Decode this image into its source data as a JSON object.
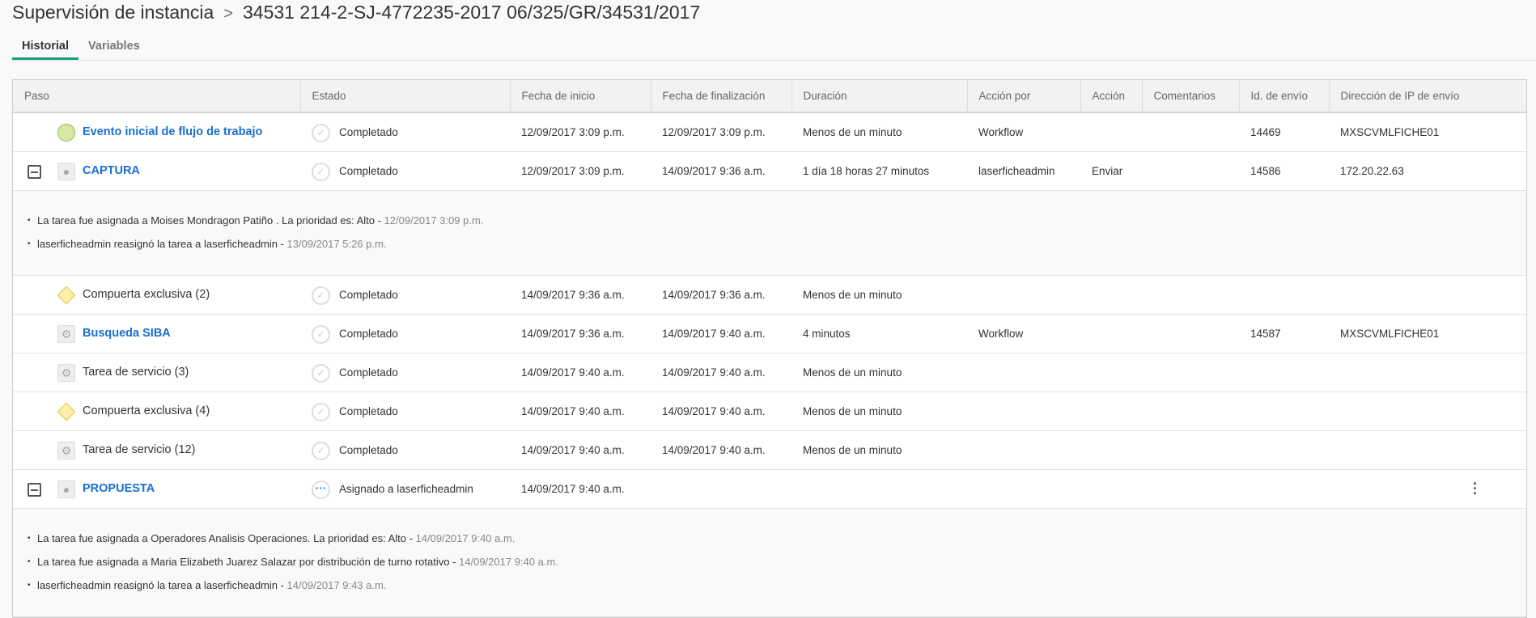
{
  "header": {
    "title": "Supervisión de instancia",
    "instance": "34531 214-2-SJ-4772235-2017 06/325/GR/34531/2017"
  },
  "tabs": [
    "Historial",
    "Variables"
  ],
  "columns": [
    "Paso",
    "Estado",
    "Fecha de inicio",
    "Fecha de finalización",
    "Duración",
    "Acción por",
    "Acción",
    "Comentarios",
    "Id. de envío",
    "Dirección de IP de envío"
  ],
  "rows": [
    {
      "icon": "start-event-icon",
      "paso": "Evento inicial de flujo de trabajo",
      "link": true,
      "estado": "Completado",
      "inicio": "12/09/2017 3:09 p.m.",
      "fin": "12/09/2017 3:09 p.m.",
      "duracion": "Menos de un minuto",
      "por": "Workflow",
      "accion": "",
      "comentarios": "",
      "id": "14469",
      "ip": "MXSCVMLFICHE01"
    },
    {
      "icon": "user-task-icon",
      "expandable": true,
      "paso": "CAPTURA",
      "link": true,
      "estado": "Completado",
      "inicio": "12/09/2017 3:09 p.m.",
      "fin": "14/09/2017 9:36 a.m.",
      "duracion": "1 día 18 horas 27 minutos",
      "por": "laserficheadmin",
      "accion": "Enviar",
      "comentarios": "",
      "id": "14586",
      "ip": "172.20.22.63",
      "details": [
        {
          "text": "La tarea fue asignada a Moises Mondragon Patiño . La prioridad es: Alto - ",
          "ts": "12/09/2017 3:09 p.m."
        },
        {
          "text": "laserficheadmin reasignó la tarea a laserficheadmin - ",
          "ts": "13/09/2017 5:26 p.m."
        }
      ]
    },
    {
      "icon": "gateway-icon",
      "paso": "Compuerta exclusiva (2)",
      "estado": "Completado",
      "inicio": "14/09/2017 9:36 a.m.",
      "fin": "14/09/2017 9:36 a.m.",
      "duracion": "Menos de un minuto",
      "por": "",
      "accion": "",
      "comentarios": "",
      "id": "",
      "ip": ""
    },
    {
      "icon": "service-task-icon",
      "paso": "Busqueda SIBA",
      "link": true,
      "estado": "Completado",
      "inicio": "14/09/2017 9:36 a.m.",
      "fin": "14/09/2017 9:40 a.m.",
      "duracion": "4 minutos",
      "por": "Workflow",
      "accion": "",
      "comentarios": "",
      "id": "14587",
      "ip": "MXSCVMLFICHE01"
    },
    {
      "icon": "service-task-icon",
      "paso": "Tarea de servicio (3)",
      "estado": "Completado",
      "inicio": "14/09/2017 9:40 a.m.",
      "fin": "14/09/2017 9:40 a.m.",
      "duracion": "Menos de un minuto",
      "por": "",
      "accion": "",
      "comentarios": "",
      "id": "",
      "ip": ""
    },
    {
      "icon": "gateway-icon",
      "paso": "Compuerta exclusiva (4)",
      "estado": "Completado",
      "inicio": "14/09/2017 9:40 a.m.",
      "fin": "14/09/2017 9:40 a.m.",
      "duracion": "Menos de un minuto",
      "por": "",
      "accion": "",
      "comentarios": "",
      "id": "",
      "ip": ""
    },
    {
      "icon": "service-task-icon",
      "paso": "Tarea de servicio (12)",
      "estado": "Completado",
      "inicio": "14/09/2017 9:40 a.m.",
      "fin": "14/09/2017 9:40 a.m.",
      "duracion": "Menos de un minuto",
      "por": "",
      "accion": "",
      "comentarios": "",
      "id": "",
      "ip": ""
    },
    {
      "icon": "user-task-icon",
      "expandable": true,
      "pending": true,
      "kebab": true,
      "paso": "PROPUESTA",
      "link": true,
      "estado": "Asignado a laserficheadmin",
      "inicio": "14/09/2017 9:40 a.m.",
      "fin": "",
      "duracion": "",
      "por": "",
      "accion": "",
      "comentarios": "",
      "id": "",
      "ip": "",
      "details": [
        {
          "text": "La tarea fue asignada a Operadores Analisis Operaciones. La prioridad es: Alto - ",
          "ts": "14/09/2017 9:40 a.m."
        },
        {
          "text": "La tarea fue asignada a Maria Elizabeth Juarez Salazar por distribución de turno rotativo - ",
          "ts": "14/09/2017 9:40 a.m."
        },
        {
          "text": "laserficheadmin reasignó la tarea a laserficheadmin - ",
          "ts": "14/09/2017 9:43 a.m."
        }
      ]
    }
  ]
}
